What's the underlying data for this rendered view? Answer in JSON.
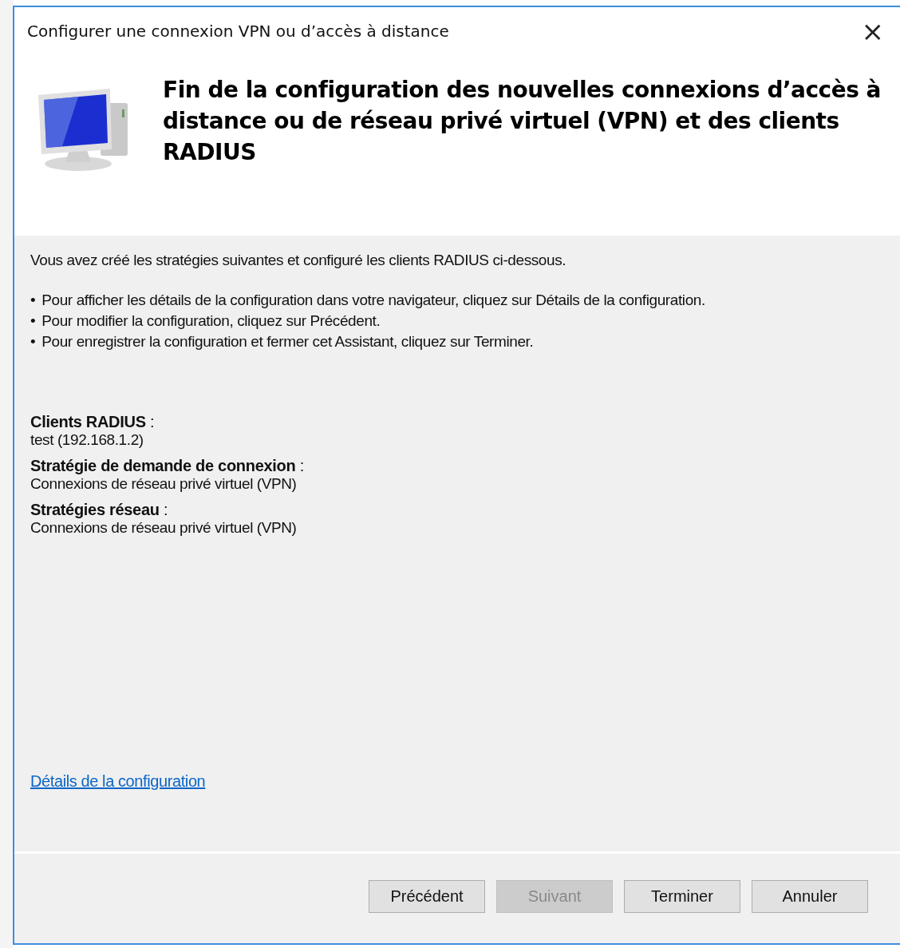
{
  "window": {
    "title": "Configurer une connexion VPN ou d’accès à distance",
    "close": "×"
  },
  "header": {
    "title": "Fin de la configuration des nouvelles connexions d’accès à distance ou de réseau privé virtuel (VPN) et des clients RADIUS"
  },
  "intro": "Vous avez créé les stratégies suivantes et configuré les clients RADIUS ci-dessous.",
  "bullets": [
    {
      "mark": "•",
      "text": "Pour afficher les détails de la configuration dans votre navigateur, cliquez sur Détails de la configuration."
    },
    {
      "mark": "•",
      "text": "Pour modifier la configuration, cliquez sur Précédent."
    },
    {
      "mark": "•",
      "text": "Pour enregistrer la configuration et fermer cet Assistant, cliquez sur Terminer."
    }
  ],
  "summary": [
    {
      "label": "**Clients RADIUS** :",
      "value": "test (192.168.1.2)"
    },
    {
      "label": "**Stratégie de demande de connexion** :",
      "value": "Connexions de réseau privé virtuel (VPN)"
    },
    {
      "label": "**Stratégies réseau** :",
      "value": "Connexions de réseau privé virtuel (VPN)"
    }
  ],
  "link": "Détails de la configuration",
  "buttons": [
    {
      "label": "Précédent",
      "disabled": false
    },
    {
      "label": "Suivant",
      "disabled": true
    },
    {
      "label": "Terminer",
      "disabled": false
    },
    {
      "label": "Annuler",
      "disabled": false
    }
  ]
}
